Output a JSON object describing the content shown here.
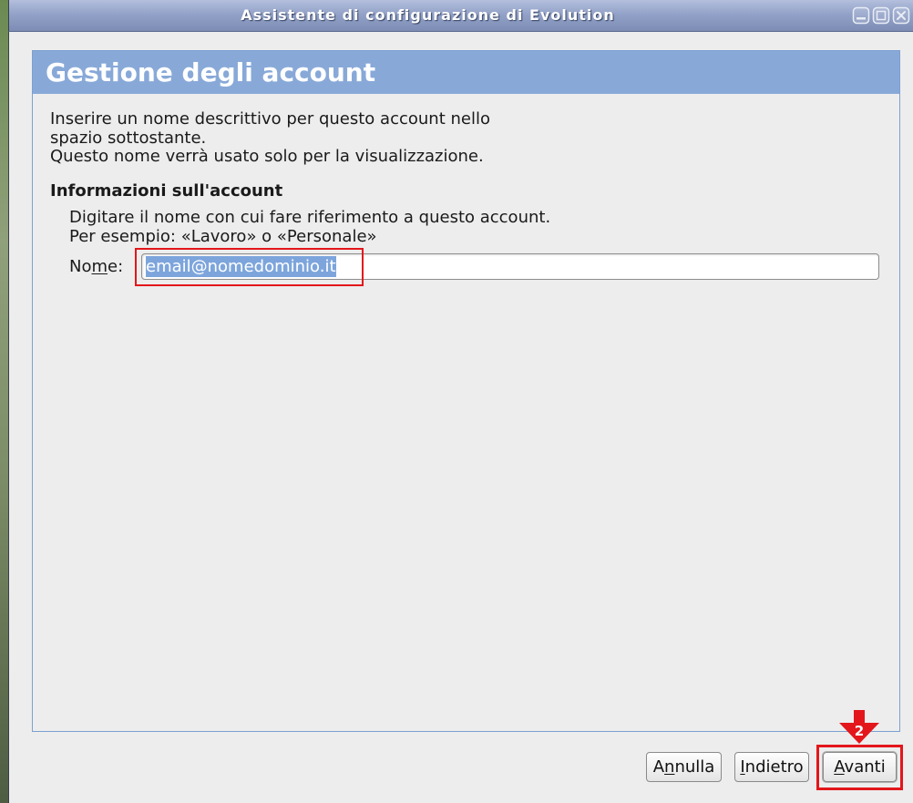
{
  "window": {
    "title": "Assistente di configurazione di Evolution",
    "controls": {
      "minimize": "minimize-icon",
      "maximize": "maximize-icon",
      "close": "close-icon"
    }
  },
  "assistant_page": {
    "header": "Gestione degli account",
    "intro_lines": [
      "Inserire un nome descrittivo per questo account nello",
      "spazio sottostante.",
      "Questo nome verrà usato solo per la visualizzazione."
    ],
    "section_title": "Informazioni sull'account",
    "hint_lines": [
      "Digitare il nome con cui fare riferimento a questo account.",
      "Per esempio: «Lavoro» o «Personale»"
    ],
    "name_field": {
      "label": "Nome:",
      "access_key": "m",
      "value": "email@nomedominio.it",
      "value_selected": true
    }
  },
  "buttons": {
    "cancel": {
      "label": "Annulla",
      "access_key": "n"
    },
    "back": {
      "label": "Indietro",
      "access_key": "I"
    },
    "next": {
      "label": "Avanti",
      "access_key": "A"
    }
  },
  "annotations": {
    "step_number": "2"
  },
  "colors": {
    "window_bg": "#ededed",
    "titlebar_top": "#b3bfdc",
    "titlebar_bottom": "#7c8cb4",
    "header_bg": "#88a9d8",
    "panel_border": "#7c9fd2",
    "selection_bg": "#7da5dc",
    "annotation_red": "#e3161b"
  }
}
